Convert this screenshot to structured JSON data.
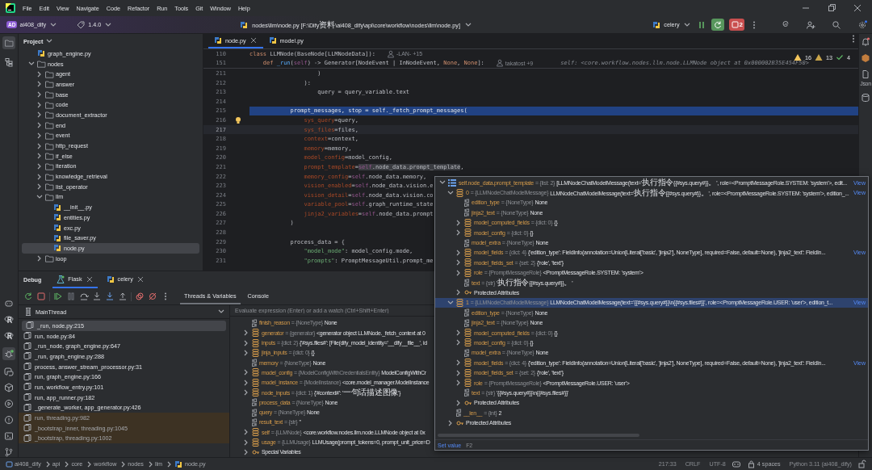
{
  "menu": [
    "File",
    "Edit",
    "View",
    "Navigate",
    "Code",
    "Refactor",
    "Run",
    "Tools",
    "Git",
    "Window",
    "Help"
  ],
  "toolbar": {
    "project_badge": "AD",
    "project": "ai408_dify",
    "version": "1.4.0",
    "file_path": "nodes\\llm\\node.py [F:\\Dify资料\\ai408_dify\\api\\core\\workflow\\nodes\\llm\\node.py]",
    "run_config": "celery",
    "stop_count": "2"
  },
  "project_panel": {
    "title": "Project",
    "tree": [
      {
        "label": "graph_engine.py",
        "kind": "file",
        "selected": false
      },
      {
        "label": "nodes",
        "kind": "folder",
        "expanded": true,
        "selected": false,
        "children": [
          {
            "label": "agent",
            "kind": "folder",
            "expanded": false,
            "selected": false
          },
          {
            "label": "answer",
            "kind": "folder",
            "expanded": false,
            "selected": false
          },
          {
            "label": "base",
            "kind": "folder",
            "expanded": false,
            "selected": false
          },
          {
            "label": "code",
            "kind": "folder",
            "expanded": false,
            "selected": false
          },
          {
            "label": "document_extractor",
            "kind": "folder",
            "expanded": false,
            "selected": false
          },
          {
            "label": "end",
            "kind": "folder",
            "expanded": false,
            "selected": false
          },
          {
            "label": "event",
            "kind": "folder",
            "expanded": false,
            "selected": false
          },
          {
            "label": "http_request",
            "kind": "folder",
            "expanded": false,
            "selected": false
          },
          {
            "label": "if_else",
            "kind": "folder",
            "expanded": false,
            "selected": false
          },
          {
            "label": "iteration",
            "kind": "folder",
            "expanded": false,
            "selected": false
          },
          {
            "label": "knowledge_retrieval",
            "kind": "folder",
            "expanded": false,
            "selected": false
          },
          {
            "label": "list_operator",
            "kind": "folder",
            "expanded": false,
            "selected": false
          },
          {
            "label": "llm",
            "kind": "folder",
            "expanded": true,
            "selected": false,
            "children": [
              {
                "label": "__init__.py",
                "kind": "file",
                "selected": false
              },
              {
                "label": "entities.py",
                "kind": "file",
                "selected": false
              },
              {
                "label": "exc.py",
                "kind": "file",
                "selected": false
              },
              {
                "label": "file_saver.py",
                "kind": "file",
                "selected": false
              },
              {
                "label": "node.py",
                "kind": "file",
                "selected": true
              }
            ]
          },
          {
            "label": "loop",
            "kind": "folder",
            "expanded": false,
            "selected": false
          }
        ]
      }
    ]
  },
  "editor": {
    "tabs": [
      {
        "label": "node.py",
        "selected": true
      },
      {
        "label": "model.py",
        "selected": false
      }
    ],
    "inspections": {
      "warnings": "16",
      "weak_warnings": "13",
      "ok": "4"
    },
    "sticky_lines": [
      {
        "number": "110",
        "tokens": [
          {
            "text": "class ",
            "kind": "keyword"
          },
          {
            "text": "LLMNode(BaseNode[LLMNodeData]):",
            "kind": "plain"
          }
        ],
        "author": "-LAN- +15"
      },
      {
        "number": "151",
        "tokens": [
          {
            "text": "    def ",
            "kind": "keyword"
          },
          {
            "text": "_run",
            "kind": "function"
          },
          {
            "text": "(",
            "kind": "plain"
          },
          {
            "text": "self",
            "kind": "self"
          },
          {
            "text": ") -> Generator[NodeEvent | InNodeEvent, ",
            "kind": "plain"
          },
          {
            "text": "None",
            "kind": "keyword"
          },
          {
            "text": ", ",
            "kind": "plain"
          },
          {
            "text": "None",
            "kind": "keyword"
          },
          {
            "text": "]:",
            "kind": "plain"
          }
        ],
        "author": "takatost +9",
        "hint": "self: <core.workflow.nodes.llm.node.LLMNode object at 0x000002B35E454F50>"
      }
    ],
    "lines": [
      {
        "number": "211",
        "execution": false,
        "caret": false,
        "bulb": false,
        "tokens": [
          {
            "text": "                    )",
            "kind": "plain"
          }
        ]
      },
      {
        "number": "212",
        "execution": false,
        "caret": false,
        "bulb": false,
        "tokens": [
          {
            "text": "                ):",
            "kind": "plain"
          }
        ]
      },
      {
        "number": "213",
        "execution": false,
        "caret": false,
        "bulb": false,
        "tokens": [
          {
            "text": "                    query = query_variable.text",
            "kind": "plain"
          }
        ]
      },
      {
        "number": "214",
        "execution": false,
        "caret": false,
        "bulb": false
      },
      {
        "number": "215",
        "execution": true,
        "caret": false,
        "bulb": false,
        "tokens": [
          {
            "text": "            prompt_messages, stop = ",
            "kind": "plain"
          },
          {
            "text": "self",
            "kind": "self"
          },
          {
            "text": "._fetch_prompt_messages(",
            "kind": "plain"
          }
        ]
      },
      {
        "number": "216",
        "execution": false,
        "caret": false,
        "bulb": true,
        "tokens": [
          {
            "text": "                sys_query",
            "kind": "param"
          },
          {
            "text": "=query,",
            "kind": "plain"
          }
        ]
      },
      {
        "number": "217",
        "execution": false,
        "caret": true,
        "bulb": false,
        "tokens": [
          {
            "text": "                sys_files",
            "kind": "param"
          },
          {
            "text": "=files,",
            "kind": "plain"
          }
        ]
      },
      {
        "number": "218",
        "execution": false,
        "caret": false,
        "bulb": false,
        "tokens": [
          {
            "text": "                context",
            "kind": "param"
          },
          {
            "text": "=context,",
            "kind": "plain"
          }
        ]
      },
      {
        "number": "219",
        "execution": false,
        "caret": false,
        "bulb": false,
        "tokens": [
          {
            "text": "                memory",
            "kind": "param"
          },
          {
            "text": "=memory,",
            "kind": "plain"
          }
        ]
      },
      {
        "number": "220",
        "execution": false,
        "caret": false,
        "bulb": false,
        "tokens": [
          {
            "text": "                model_config",
            "kind": "param"
          },
          {
            "text": "=model_config,",
            "kind": "plain"
          }
        ]
      },
      {
        "number": "221",
        "execution": false,
        "caret": false,
        "bulb": false,
        "tokens": [
          {
            "text": "                prompt_template",
            "kind": "param"
          },
          {
            "text": "=",
            "kind": "plain"
          },
          {
            "text": "self",
            "kind": "self_hover"
          },
          {
            "text": ".node_data.prompt_template",
            "kind": "plain_hover"
          },
          {
            "text": ",",
            "kind": "plain"
          }
        ]
      },
      {
        "number": "222",
        "execution": false,
        "caret": false,
        "bulb": false,
        "tokens": [
          {
            "text": "                memory_config",
            "kind": "param"
          },
          {
            "text": "=",
            "kind": "plain"
          },
          {
            "text": "self",
            "kind": "self"
          },
          {
            "text": ".node_data.memory,",
            "kind": "plain"
          }
        ]
      },
      {
        "number": "223",
        "execution": false,
        "caret": false,
        "bulb": false,
        "tokens": [
          {
            "text": "                vision_enabled",
            "kind": "param"
          },
          {
            "text": "=",
            "kind": "plain"
          },
          {
            "text": "self",
            "kind": "self"
          },
          {
            "text": ".node_data.vision.e",
            "kind": "plain"
          }
        ]
      },
      {
        "number": "224",
        "execution": false,
        "caret": false,
        "bulb": false,
        "tokens": [
          {
            "text": "                vision_detail",
            "kind": "param"
          },
          {
            "text": "=",
            "kind": "plain"
          },
          {
            "text": "self",
            "kind": "self"
          },
          {
            "text": ".node_data.vision.co",
            "kind": "plain"
          }
        ]
      },
      {
        "number": "225",
        "execution": false,
        "caret": false,
        "bulb": false,
        "tokens": [
          {
            "text": "                variable_pool",
            "kind": "param"
          },
          {
            "text": "=",
            "kind": "plain"
          },
          {
            "text": "self",
            "kind": "self"
          },
          {
            "text": ".graph_runtime_state",
            "kind": "plain"
          }
        ]
      },
      {
        "number": "226",
        "execution": false,
        "caret": false,
        "bulb": false,
        "tokens": [
          {
            "text": "                jinja2_variables",
            "kind": "param"
          },
          {
            "text": "=",
            "kind": "plain"
          },
          {
            "text": "self",
            "kind": "self"
          },
          {
            "text": ".node_data.prompt",
            "kind": "plain"
          }
        ]
      },
      {
        "number": "227",
        "execution": false,
        "caret": false,
        "bulb": false,
        "tokens": [
          {
            "text": "            )",
            "kind": "plain"
          }
        ]
      },
      {
        "number": "228",
        "execution": false,
        "caret": false,
        "bulb": false
      },
      {
        "number": "229",
        "execution": false,
        "caret": false,
        "bulb": false,
        "tokens": [
          {
            "text": "            process_data = {",
            "kind": "plain"
          }
        ]
      },
      {
        "number": "230",
        "execution": false,
        "caret": false,
        "bulb": false,
        "tokens": [
          {
            "text": "                \"model_mode\"",
            "kind": "string"
          },
          {
            "text": ": model_config.mode,",
            "kind": "plain"
          }
        ]
      },
      {
        "number": "231",
        "execution": false,
        "caret": false,
        "bulb": false,
        "tokens": [
          {
            "text": "                \"prompts\"",
            "kind": "string"
          },
          {
            "text": ": PromptMessageUtil.prompt_me",
            "kind": "plain"
          }
        ]
      }
    ]
  },
  "right_strip": {
    "label": "Json"
  },
  "debug": {
    "title": "Debug",
    "sessions": [
      {
        "label": "Flask",
        "selected": true
      },
      {
        "label": "celery",
        "selected": false
      }
    ],
    "tabs": [
      {
        "label": "Threads & Variables",
        "selected": true
      },
      {
        "label": "Console",
        "selected": false
      }
    ],
    "thread": "MainThread",
    "frames": [
      {
        "label": "_run, node.py:215",
        "selected": true,
        "library": false
      },
      {
        "label": "run, node.py:84",
        "selected": false,
        "library": false
      },
      {
        "label": "_run_node, graph_engine.py:647",
        "selected": false,
        "library": false
      },
      {
        "label": "_run, graph_engine.py:288",
        "selected": false,
        "library": false
      },
      {
        "label": "process, answer_stream_processor.py:31",
        "selected": false,
        "library": false
      },
      {
        "label": "run, graph_engine.py:166",
        "selected": false,
        "library": false
      },
      {
        "label": "run, workflow_entry.py:101",
        "selected": false,
        "library": false
      },
      {
        "label": "run, app_runner.py:182",
        "selected": false,
        "library": false
      },
      {
        "label": "_generate_worker, app_generator.py:426",
        "selected": false,
        "library": false
      },
      {
        "label": "run, threading.py:982",
        "selected": false,
        "library": true
      },
      {
        "label": "_bootstrap_inner, threading.py:1045",
        "selected": false,
        "library": true
      },
      {
        "label": "_bootstrap, threading.py:1002",
        "selected": false,
        "library": true
      }
    ],
    "evaluate_placeholder": "Evaluate expression (Enter) or add a watch (Ctrl+Shift+Enter)",
    "variables": [
      {
        "name": "finish_reason",
        "type": "= {NoneType}",
        "value": "None",
        "kind": "primitive"
      },
      {
        "name": "generator",
        "type": "= {generator}",
        "value": "<generator object LLMNode._fetch_context at 0",
        "kind": "object",
        "expanded": false
      },
      {
        "name": "inputs",
        "type": "= {dict: 2}",
        "value": "{'#sys.files#': [File(dify_model_identity='__dify__file__', id",
        "kind": "object",
        "expanded": false
      },
      {
        "name": "jinja_inputs",
        "type": "= {dict: 0}",
        "value": "{}",
        "kind": "object",
        "expanded": false
      },
      {
        "name": "memory",
        "type": "= {NoneType}",
        "value": "None",
        "kind": "primitive"
      },
      {
        "name": "model_config",
        "type": "= {ModelConfigWithCredentialsEntity}",
        "value": "ModelConfigWithCr",
        "kind": "object",
        "expanded": false
      },
      {
        "name": "model_instance",
        "type": "= {ModelInstance}",
        "value": "<core.model_manager.ModelInstance",
        "kind": "object",
        "expanded": false
      },
      {
        "name": "node_inputs",
        "type": "= {dict: 1}",
        "value": "{'#context#': '一句话描述图像'}",
        "kind": "object",
        "expanded": false
      },
      {
        "name": "process_data",
        "type": "= {NoneType}",
        "value": "None",
        "kind": "primitive"
      },
      {
        "name": "query",
        "type": "= {NoneType}",
        "value": "None",
        "kind": "primitive"
      },
      {
        "name": "result_text",
        "type": "= {str}",
        "value": "''",
        "kind": "primitive"
      },
      {
        "name": "self",
        "type": "= {LLMNode}",
        "value": "<core.workflow.nodes.llm.node.LLMNode object at 0x",
        "kind": "object",
        "expanded": false
      },
      {
        "name": "usage",
        "type": "= {LLMUsage}",
        "value": "LLMUsage(prompt_tokens=0, prompt_unit_price=D",
        "kind": "object",
        "expanded": false
      },
      {
        "name": "Special Variables",
        "kind": "group",
        "expanded": false
      }
    ]
  },
  "popup": {
    "tree": [
      {
        "name": "self.node_data.prompt_template",
        "type": "= {list: 2}",
        "value": "[LLMNodeChatModelMessage(text='执行指令{{#sys.query#}}。', role=<PromptMessageRole.SYSTEM: 'system'>, edit...",
        "link": "View",
        "kind": "list",
        "expanded": true,
        "selected": false,
        "children": [
          {
            "name": "0",
            "type": "= {LLMNodeChatModelMessage}",
            "value": "LLMNodeChatModelMessage(text='执行指令{{#sys.query#}}。', role=<PromptMessageRole.SYSTEM: 'system'>, edition_...",
            "link": "View",
            "kind": "object",
            "expanded": true,
            "selected": false,
            "children": [
              {
                "name": "edition_type",
                "type": "= {NoneType}",
                "value": "None",
                "kind": "primitive",
                "selected": false
              },
              {
                "name": "jinja2_text",
                "type": "= {NoneType}",
                "value": "None",
                "kind": "primitive",
                "selected": false
              },
              {
                "name": "model_computed_fields",
                "type": "= {dict: 0}",
                "value": "{}",
                "kind": "object",
                "expanded": false,
                "selected": false
              },
              {
                "name": "model_config",
                "type": "= {dict: 0}",
                "value": "{}",
                "kind": "object",
                "expanded": false,
                "selected": false
              },
              {
                "name": "model_extra",
                "type": "= {NoneType}",
                "value": "None",
                "kind": "primitive",
                "selected": false
              },
              {
                "name": "model_fields",
                "type": "= {dict: 4}",
                "value": "{'edition_type': FieldInfo(annotation=Union[Literal['basic', 'jinja2'], NoneType], required=False, default=None), 'jinja2_text': FieldIn...",
                "link": "View",
                "kind": "object",
                "expanded": false,
                "selected": false
              },
              {
                "name": "model_fields_set",
                "type": "= {set: 2}",
                "value": "{'role', 'text'}",
                "kind": "object",
                "expanded": false,
                "selected": false
              },
              {
                "name": "role",
                "type": "= {PromptMessageRole}",
                "value": "<PromptMessageRole.SYSTEM: 'system'>",
                "kind": "object",
                "expanded": false,
                "selected": false
              },
              {
                "name": "text",
                "type": "= {str}",
                "value": "'执行指令{{#sys.query#}}。'",
                "kind": "primitive",
                "selected": false
              },
              {
                "name": "Protected Attributes",
                "kind": "group",
                "expanded": false,
                "selected": false
              }
            ]
          },
          {
            "name": "1",
            "type": "= {LLMNodeChatModelMessage}",
            "value": "LLMNodeChatModelMessage(text='{{#sys.query#}}\\n{{#sys.files#}}', role=<PromptMessageRole.USER: 'user'>, edition_t...",
            "link": "View",
            "kind": "object",
            "expanded": true,
            "selected": true,
            "children": [
              {
                "name": "edition_type",
                "type": "= {NoneType}",
                "value": "None",
                "kind": "primitive",
                "selected": false
              },
              {
                "name": "jinja2_text",
                "type": "= {NoneType}",
                "value": "None",
                "kind": "primitive",
                "selected": false
              },
              {
                "name": "model_computed_fields",
                "type": "= {dict: 0}",
                "value": "{}",
                "kind": "object",
                "expanded": false,
                "selected": false
              },
              {
                "name": "model_config",
                "type": "= {dict: 0}",
                "value": "{}",
                "kind": "object",
                "expanded": false,
                "selected": false
              },
              {
                "name": "model_extra",
                "type": "= {NoneType}",
                "value": "None",
                "kind": "primitive",
                "selected": false
              },
              {
                "name": "model_fields",
                "type": "= {dict: 4}",
                "value": "{'edition_type': FieldInfo(annotation=Union[Literal['basic', 'jinja2'], NoneType], required=False, default=None), 'jinja2_text': FieldIn...",
                "link": "View",
                "kind": "object",
                "expanded": false,
                "selected": false
              },
              {
                "name": "model_fields_set",
                "type": "= {set: 2}",
                "value": "{'role', 'text'}",
                "kind": "object",
                "expanded": false,
                "selected": false
              },
              {
                "name": "role",
                "type": "= {PromptMessageRole}",
                "value": "<PromptMessageRole.USER: 'user'>",
                "kind": "object",
                "expanded": false,
                "selected": false
              },
              {
                "name": "text",
                "type": "= {str}",
                "value": "'{{#sys.query#}}\\n{{#sys.files#}}'",
                "kind": "primitive",
                "selected": false
              },
              {
                "name": "Protected Attributes",
                "kind": "group",
                "expanded": false,
                "selected": false
              }
            ]
          },
          {
            "name": "__len__",
            "type": "= {int}",
            "value": "2",
            "kind": "primitive",
            "selected": false
          },
          {
            "name": "Protected Attributes",
            "kind": "group",
            "expanded": false,
            "selected": false
          }
        ]
      }
    ],
    "action": "Set value",
    "shortcut": "F2"
  },
  "status_bar": {
    "breadcrumbs": [
      {
        "label": "ai408_dify",
        "kind": "module"
      },
      {
        "label": "api",
        "kind": "folder"
      },
      {
        "label": "core",
        "kind": "folder"
      },
      {
        "label": "workflow",
        "kind": "folder"
      },
      {
        "label": "nodes",
        "kind": "folder"
      },
      {
        "label": "llm",
        "kind": "folder"
      },
      {
        "label": "node.py",
        "kind": "file"
      }
    ],
    "position": "217:33",
    "line_ending": "CRLF",
    "encoding": "UTF-8",
    "indent": "4 spaces",
    "interpreter": "Python 3.11 (ai408_dify)"
  }
}
